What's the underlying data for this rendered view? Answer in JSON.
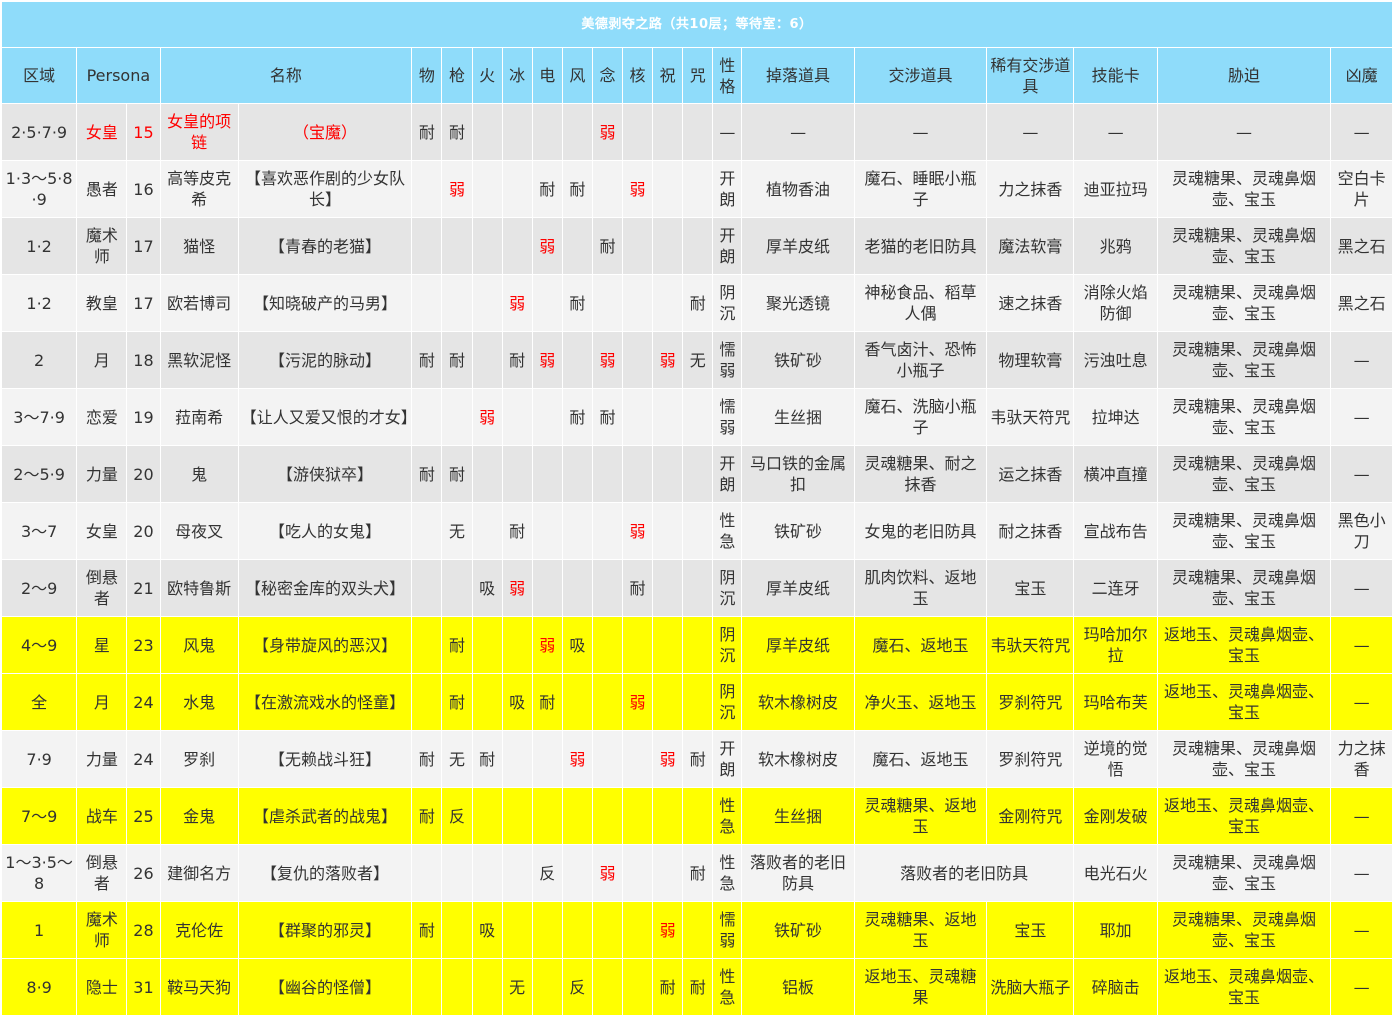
{
  "title": "美德剥夺之路（共10层；等待室：6）",
  "headers": [
    "区域",
    "Persona",
    "名称",
    "物",
    "枪",
    "火",
    "冰",
    "电",
    "风",
    "念",
    "核",
    "祝",
    "咒",
    "性格",
    "掉落道具",
    "交涉道具",
    "稀有交涉道具",
    "技能卡",
    "胁迫",
    "凶魔"
  ],
  "colors": {
    "header_bg": "#8fdcfa",
    "row_gray": "#e5e5e5",
    "row_white": "#f3f3f3",
    "row_highlight": "#ffff00",
    "weak_text": "#ff0000"
  },
  "rows": [
    {
      "style": "gray",
      "area": "2·5·7·9",
      "arcana": "女皇",
      "level": "15",
      "persona": "女皇的项链",
      "name": "（宝魔）",
      "res": [
        "耐",
        "耐",
        "",
        "",
        "",
        "",
        "弱",
        "",
        "",
        ""
      ],
      "trait": "—",
      "drop": "—",
      "nego": "—",
      "rare": "—",
      "card": "—",
      "threat": "—",
      "fiend": "—"
    },
    {
      "style": "white",
      "area": "1·3～5·8·9",
      "arcana": "愚者",
      "level": "16",
      "persona": "高等皮克希",
      "name": "【喜欢恶作剧的少女队长】",
      "res": [
        "",
        "弱",
        "",
        "",
        "耐",
        "耐",
        "",
        "弱",
        "",
        ""
      ],
      "trait": "开朗",
      "drop": "植物香油",
      "nego": "魔石、睡眠小瓶子",
      "rare": "力之抹香",
      "card": "迪亚拉玛",
      "threat": "灵魂糖果、灵魂鼻烟壶、宝玉",
      "fiend": "空白卡片"
    },
    {
      "style": "gray",
      "area": "1·2",
      "arcana": "魔术师",
      "level": "17",
      "persona": "猫怪",
      "name": "【青春的老猫】",
      "res": [
        "",
        "",
        "",
        "",
        "弱",
        "",
        "耐",
        "",
        "",
        ""
      ],
      "trait": "开朗",
      "drop": "厚羊皮纸",
      "nego": "老猫的老旧防具",
      "rare": "魔法软膏",
      "card": "兆鸦",
      "threat": "灵魂糖果、灵魂鼻烟壶、宝玉",
      "fiend": "黑之石"
    },
    {
      "style": "white",
      "area": "1·2",
      "arcana": "教皇",
      "level": "17",
      "persona": "欧若博司",
      "name": "【知晓破产的马男】",
      "res": [
        "",
        "",
        "",
        "弱",
        "",
        "耐",
        "",
        "",
        "",
        "耐"
      ],
      "trait": "阴沉",
      "drop": "聚光透镜",
      "nego": "神秘食品、稻草人偶",
      "rare": "速之抹香",
      "card": "消除火焰防御",
      "threat": "灵魂糖果、灵魂鼻烟壶、宝玉",
      "fiend": "黑之石"
    },
    {
      "style": "gray",
      "area": "2",
      "arcana": "月",
      "level": "18",
      "persona": "黑软泥怪",
      "name": "【污泥的脉动】",
      "res": [
        "耐",
        "耐",
        "",
        "耐",
        "弱",
        "",
        "弱",
        "",
        "弱",
        "无"
      ],
      "trait": "懦弱",
      "drop": "铁矿砂",
      "nego": "香气卤汁、恐怖小瓶子",
      "rare": "物理软膏",
      "card": "污浊吐息",
      "threat": "灵魂糖果、灵魂鼻烟壶、宝玉",
      "fiend": "—"
    },
    {
      "style": "white",
      "area": "3～7·9",
      "arcana": "恋爱",
      "level": "19",
      "persona": "菈南希",
      "name": "【让人又爱又恨的才女】",
      "res": [
        "",
        "",
        "弱",
        "",
        "",
        "耐",
        "耐",
        "",
        "",
        ""
      ],
      "trait": "懦弱",
      "drop": "生丝捆",
      "nego": "魔石、洗脑小瓶子",
      "rare": "韦驮天符咒",
      "card": "拉坤达",
      "threat": "灵魂糖果、灵魂鼻烟壶、宝玉",
      "fiend": "—"
    },
    {
      "style": "gray",
      "area": "2～5·9",
      "arcana": "力量",
      "level": "20",
      "persona": "鬼",
      "name": "【游侠狱卒】",
      "res": [
        "耐",
        "耐",
        "",
        "",
        "",
        "",
        "",
        "",
        "",
        ""
      ],
      "trait": "开朗",
      "drop": "马口铁的金属扣",
      "nego": "灵魂糖果、耐之抹香",
      "rare": "运之抹香",
      "card": "横冲直撞",
      "threat": "灵魂糖果、灵魂鼻烟壶、宝玉",
      "fiend": "—"
    },
    {
      "style": "white",
      "area": "3～7",
      "arcana": "女皇",
      "level": "20",
      "persona": "母夜叉",
      "name": "【吃人的女鬼】",
      "res": [
        "",
        "无",
        "",
        "耐",
        "",
        "",
        "",
        "弱",
        "",
        ""
      ],
      "trait": "性急",
      "drop": "铁矿砂",
      "nego": "女鬼的老旧防具",
      "rare": "耐之抹香",
      "card": "宣战布告",
      "threat": "灵魂糖果、灵魂鼻烟壶、宝玉",
      "fiend": "黑色小刀"
    },
    {
      "style": "gray",
      "area": "2～9",
      "arcana": "倒悬者",
      "level": "21",
      "persona": "欧特鲁斯",
      "name": "【秘密金库的双头犬】",
      "res": [
        "",
        "",
        "吸",
        "弱",
        "",
        "",
        "",
        "耐",
        "",
        ""
      ],
      "trait": "阴沉",
      "drop": "厚羊皮纸",
      "nego": "肌肉饮料、返地玉",
      "rare": "宝玉",
      "card": "二连牙",
      "threat": "灵魂糖果、灵魂鼻烟壶、宝玉",
      "fiend": "—"
    },
    {
      "style": "yellow",
      "area": "4～9",
      "arcana": "星",
      "level": "23",
      "persona": "风鬼",
      "name": "【身带旋风的恶汉】",
      "res": [
        "",
        "耐",
        "",
        "",
        "弱",
        "吸",
        "",
        "",
        "",
        ""
      ],
      "trait": "阴沉",
      "drop": "厚羊皮纸",
      "nego": "魔石、返地玉",
      "rare": "韦驮天符咒",
      "card": "玛哈加尔拉",
      "threat": "返地玉、灵魂鼻烟壶、宝玉",
      "fiend": "—"
    },
    {
      "style": "yellow",
      "area": "全",
      "arcana": "月",
      "level": "24",
      "persona": "水鬼",
      "name": "【在激流戏水的怪童】",
      "res": [
        "",
        "耐",
        "",
        "吸",
        "耐",
        "",
        "",
        "弱",
        "",
        ""
      ],
      "trait": "阴沉",
      "drop": "软木橡树皮",
      "nego": "净火玉、返地玉",
      "rare": "罗刹符咒",
      "card": "玛哈布芙",
      "threat": "返地玉、灵魂鼻烟壶、宝玉",
      "fiend": "—"
    },
    {
      "style": "white",
      "area": "7·9",
      "arcana": "力量",
      "level": "24",
      "persona": "罗刹",
      "name": "【无赖战斗狂】",
      "res": [
        "耐",
        "无",
        "耐",
        "",
        "",
        "弱",
        "",
        "",
        "弱",
        "耐"
      ],
      "trait": "开朗",
      "drop": "软木橡树皮",
      "nego": "魔石、返地玉",
      "rare": "罗刹符咒",
      "card": "逆境的觉悟",
      "threat": "灵魂糖果、灵魂鼻烟壶、宝玉",
      "fiend": "力之抹香"
    },
    {
      "style": "yellow",
      "area": "7～9",
      "arcana": "战车",
      "level": "25",
      "persona": "金鬼",
      "name": "【虐杀武者的战鬼】",
      "res": [
        "耐",
        "反",
        "",
        "",
        "",
        "",
        "",
        "",
        "",
        ""
      ],
      "trait": "性急",
      "drop": "生丝捆",
      "nego": "灵魂糖果、返地玉",
      "rare": "金刚符咒",
      "card": "金刚发破",
      "threat": "返地玉、灵魂鼻烟壶、宝玉",
      "fiend": "—"
    },
    {
      "style": "white",
      "area": "1～3·5～8",
      "arcana": "倒悬者",
      "level": "26",
      "persona": "建御名方",
      "name": "【复仇的落败者】",
      "res": [
        "",
        "",
        "",
        "",
        "反",
        "",
        "弱",
        "",
        "",
        "耐"
      ],
      "trait": "性急",
      "drop": "落败者的老旧防具",
      "nego": "落败者的老旧防具",
      "rare": "",
      "card": "电光石火",
      "threat": "灵魂糖果、灵魂鼻烟壶、宝玉",
      "fiend": "—"
    },
    {
      "style": "yellow",
      "area": "1",
      "arcana": "魔术师",
      "level": "28",
      "persona": "克伦佐",
      "name": "【群聚的邪灵】",
      "res": [
        "耐",
        "",
        "吸",
        "",
        "",
        "",
        "",
        "",
        "弱",
        ""
      ],
      "trait": "懦弱",
      "drop": "铁矿砂",
      "nego": "灵魂糖果、返地玉",
      "rare": "宝玉",
      "card": "耶加",
      "threat": "灵魂糖果、灵魂鼻烟壶、宝玉",
      "fiend": "—"
    },
    {
      "style": "yellow",
      "area": "8·9",
      "arcana": "隐士",
      "level": "31",
      "persona": "鞍马天狗",
      "name": "【幽谷的怪僧】",
      "res": [
        "",
        "",
        "",
        "无",
        "",
        "反",
        "",
        "",
        "耐",
        "耐"
      ],
      "trait": "性急",
      "drop": "铝板",
      "nego": "返地玉、灵魂糖果",
      "rare": "洗脑大瓶子",
      "card": "碎脑击",
      "threat": "返地玉、灵魂鼻烟壶、宝玉",
      "fiend": "—"
    }
  ]
}
